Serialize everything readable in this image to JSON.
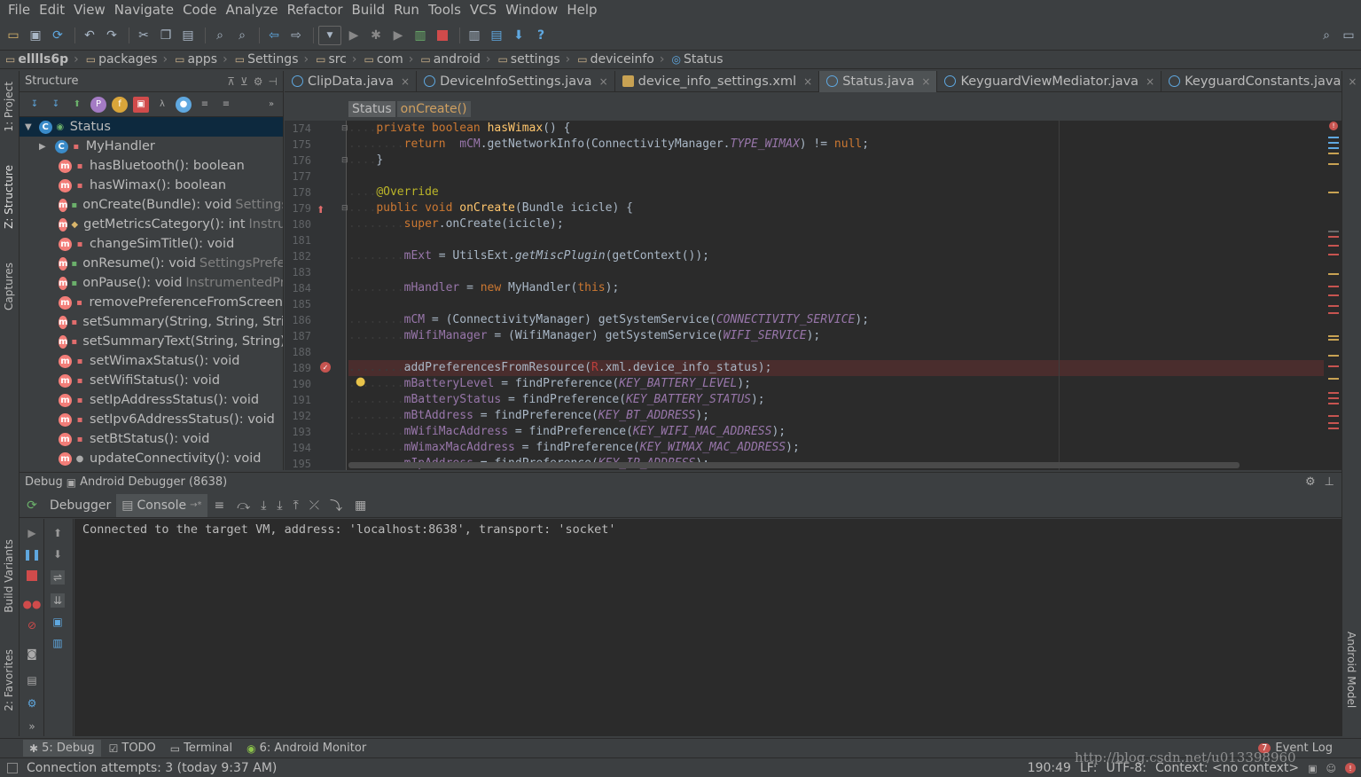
{
  "menu": [
    "File",
    "Edit",
    "View",
    "Navigate",
    "Code",
    "Analyze",
    "Refactor",
    "Build",
    "Run",
    "Tools",
    "VCS",
    "Window",
    "Help"
  ],
  "toolbar": {
    "icons": [
      "open-folder-icon",
      "save-icon",
      "sync-icon",
      "undo-icon",
      "redo-icon",
      "cut-icon",
      "copy-icon",
      "paste-icon",
      "find-icon",
      "replace-icon",
      "back-icon",
      "forward-icon",
      "run-config-dropdown",
      "run-icon",
      "debug-icon",
      "coverage-icon",
      "attach-debugger-icon",
      "stop-icon",
      "avd-manager-icon",
      "sdk-manager-icon",
      "project-structure-icon",
      "help-icon",
      "search-everywhere-icon",
      "maximize-icon"
    ]
  },
  "breadcrumb": [
    "elllls6p",
    "packages",
    "apps",
    "Settings",
    "src",
    "com",
    "android",
    "settings",
    "deviceinfo",
    "Status"
  ],
  "left_stripe": {
    "project": "1: Project",
    "structure": "Z: Structure",
    "captures": "Captures",
    "build_variants": "Build Variants",
    "favorites": "2: Favorites"
  },
  "right_stripe": {
    "android_model": "Android Model"
  },
  "structure": {
    "title": "Structure",
    "root": "Status",
    "items": [
      {
        "icon": "class",
        "access": "priv",
        "name": "MyHandler",
        "type": ""
      },
      {
        "icon": "method",
        "access": "priv",
        "name": "hasBluetooth(): boolean",
        "type": ""
      },
      {
        "icon": "method",
        "access": "priv",
        "name": "hasWimax(): boolean",
        "type": ""
      },
      {
        "icon": "method",
        "access": "pub",
        "name": "onCreate(Bundle): void",
        "type": "Settings"
      },
      {
        "icon": "method",
        "access": "prot",
        "name": "getMetricsCategory(): int",
        "type": "Instru"
      },
      {
        "icon": "method",
        "access": "priv",
        "name": "changeSimTitle(): void",
        "type": ""
      },
      {
        "icon": "method",
        "access": "pub",
        "name": "onResume(): void",
        "type": "SettingsPrefer"
      },
      {
        "icon": "method",
        "access": "pub",
        "name": "onPause(): void",
        "type": "InstrumentedPr"
      },
      {
        "icon": "method",
        "access": "priv",
        "name": "removePreferenceFromScreen",
        "type": ""
      },
      {
        "icon": "method",
        "access": "priv",
        "name": "setSummary(String, String, Strin",
        "type": ""
      },
      {
        "icon": "method",
        "access": "priv",
        "name": "setSummaryText(String, String):",
        "type": ""
      },
      {
        "icon": "method",
        "access": "priv",
        "name": "setWimaxStatus(): void",
        "type": ""
      },
      {
        "icon": "method",
        "access": "priv",
        "name": "setWifiStatus(): void",
        "type": ""
      },
      {
        "icon": "method",
        "access": "priv",
        "name": "setIpAddressStatus(): void",
        "type": ""
      },
      {
        "icon": "method",
        "access": "priv",
        "name": "setIpv6AddressStatus(): void",
        "type": ""
      },
      {
        "icon": "method",
        "access": "priv",
        "name": "setBtStatus(): void",
        "type": ""
      },
      {
        "icon": "method",
        "access": "pkg",
        "name": "updateConnectivity(): void",
        "type": ""
      }
    ]
  },
  "tabs": [
    {
      "label": "ClipData.java",
      "kind": "class",
      "active": false
    },
    {
      "label": "DeviceInfoSettings.java",
      "kind": "class",
      "active": false
    },
    {
      "label": "device_info_settings.xml",
      "kind": "xml",
      "active": false
    },
    {
      "label": "Status.java",
      "kind": "class",
      "active": true
    },
    {
      "label": "KeyguardViewMediator.java",
      "kind": "class",
      "active": false
    },
    {
      "label": "KeyguardConstants.java",
      "kind": "class",
      "active": false
    }
  ],
  "editor_crumbs": [
    "Status",
    "onCreate()"
  ],
  "code": {
    "line_numbers": [
      "174",
      "175",
      "176",
      "177",
      "178",
      "179",
      "180",
      "181",
      "182",
      "183",
      "184",
      "185",
      "186",
      "187",
      "188",
      "189",
      "190",
      "191",
      "192",
      "193",
      "194",
      "195"
    ],
    "lines": [
      "....private boolean hasWimax() {",
      "........return  mCM.getNetworkInfo(ConnectivityManager.TYPE_WIMAX) != null;",
      "....}",
      "",
      "....@Override",
      "....public void onCreate(Bundle icicle) {",
      "........super.onCreate(icicle);",
      "",
      "........mExt = UtilsExt.getMiscPlugin(getContext());",
      "",
      "........mHandler = new MyHandler(this);",
      "",
      "........mCM = (ConnectivityManager) getSystemService(CONNECTIVITY_SERVICE);",
      "........mWifiManager = (WifiManager) getSystemService(WIFI_SERVICE);",
      "",
      "........addPreferencesFromResource(R.xml.device_info_status);",
      "........mBatteryLevel = findPreference(KEY_BATTERY_LEVEL);",
      "........mBatteryStatus = findPreference(KEY_BATTERY_STATUS);",
      "........mBtAddress = findPreference(KEY_BT_ADDRESS);",
      "........mWifiMacAddress = findPreference(KEY_WIFI_MAC_ADDRESS);",
      "........mWimaxMacAddress = findPreference(KEY_WIMAX_MAC_ADDRESS);",
      "........mIpAddress = findPreference(KEY_IP_ADDRESS);"
    ]
  },
  "debug": {
    "header_label": "Debug",
    "session": "Android Debugger (8638)",
    "tab_debugger": "Debugger",
    "tab_console": "Console",
    "tab_console_suffix": "→*",
    "console_text": "Connected to the target VM, address: 'localhost:8638', transport: 'socket'"
  },
  "bottom_tabs": [
    {
      "label": "5: Debug",
      "icon": "bug-icon",
      "active": true
    },
    {
      "label": "TODO",
      "icon": "todo-icon",
      "active": false
    },
    {
      "label": "Terminal",
      "icon": "terminal-icon",
      "active": false
    },
    {
      "label": "6: Android Monitor",
      "icon": "android-icon",
      "active": false
    }
  ],
  "event_log": {
    "count": "7",
    "label": "Event Log"
  },
  "status": {
    "message": "Connection attempts: 3 (today 9:37 AM)",
    "position": "190:49",
    "line_sep": "LF:",
    "encoding": "UTF-8:",
    "context": "Context: <no context>"
  },
  "watermark": "http://blog.csdn.net/u013398960",
  "colors": {
    "keyword": "#cc7832",
    "function": "#ffc66d",
    "field": "#9876aa",
    "annotation": "#bbb529",
    "background": "#2b2b2b",
    "panel": "#3c3f41"
  }
}
